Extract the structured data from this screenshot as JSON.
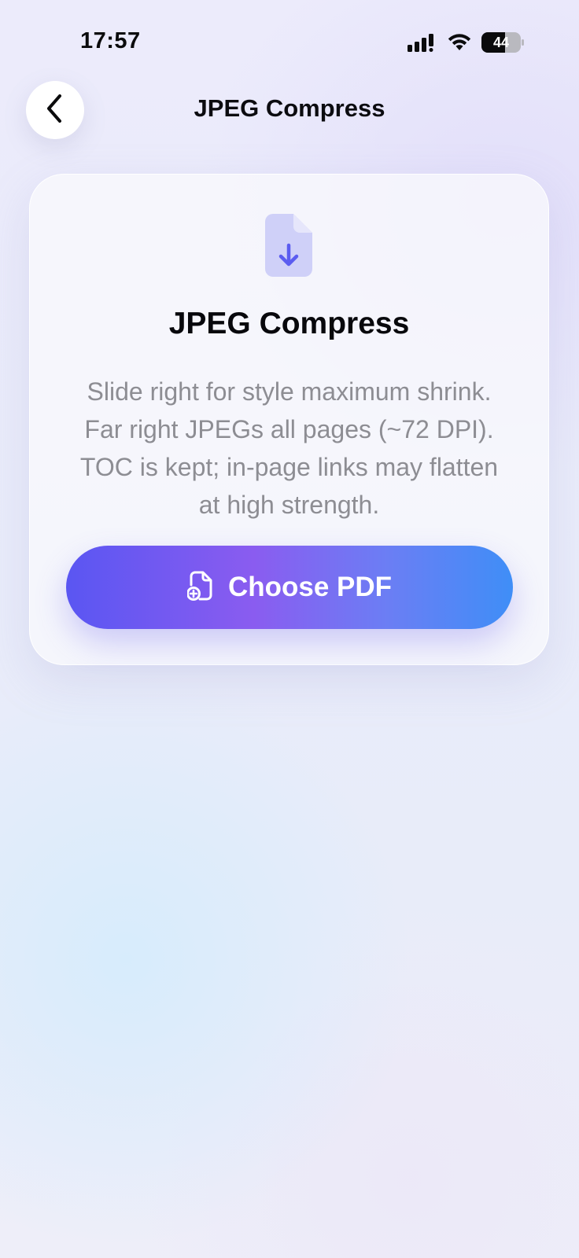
{
  "status_bar": {
    "time": "17:57",
    "battery": "44",
    "signal_icon": "cellular-signal-icon",
    "wifi_icon": "wifi-icon",
    "battery_icon": "battery-icon"
  },
  "nav": {
    "title": "JPEG Compress",
    "back_icon": "chevron-left-icon"
  },
  "card": {
    "icon": "file-download-icon",
    "title": "JPEG Compress",
    "description_lines": [
      "Slide right for style maximum shrink.",
      "Far right JPEGs all pages (~72 DPI).",
      "TOC is kept; in-page links may flatten",
      "at high strength."
    ],
    "button": {
      "label": "Choose PDF",
      "icon": "file-add-icon"
    }
  },
  "colors": {
    "accent_start": "#5a56f2",
    "accent_mid": "#8a5cf0",
    "accent_end": "#3f8ef7",
    "icon_fill": "#cfd0f8",
    "icon_arrow": "#5b5cf0",
    "text_primary": "#08080c",
    "text_secondary": "#8d8d93"
  }
}
